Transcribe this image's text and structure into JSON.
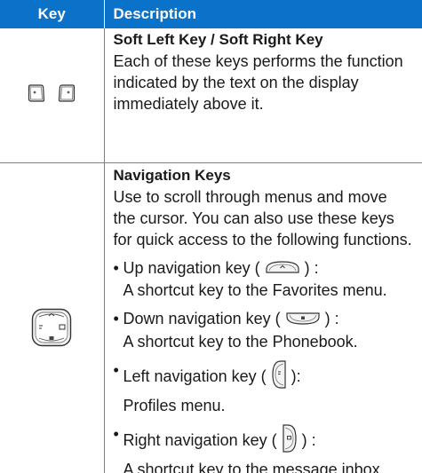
{
  "table": {
    "header": {
      "key": "Key",
      "description": "Description"
    },
    "rows": [
      {
        "title": "Soft Left Key / Soft Right Key",
        "text": "Each of these keys performs the function indicated by the text on the display immediately above it."
      },
      {
        "title": "Navigation Keys",
        "text": "Use to scroll through menus and move the cursor. You can also use these keys for quick access to the following functions.",
        "bullets": [
          {
            "lead": "Up navigation key (",
            "tail": ") :",
            "desc": "A shortcut key to the Favorites menu."
          },
          {
            "lead": "Down navigation key (",
            "tail": ") :",
            "desc": "A shortcut key to the Phonebook."
          },
          {
            "lead": "Left navigation key (",
            "tail": "):",
            "desc": "Profiles menu."
          },
          {
            "lead": "Right navigation key (",
            "tail": ") :",
            "desc": "A shortcut key to the message inbox"
          }
        ]
      }
    ]
  },
  "colors": {
    "header_bg": "#0b72c9",
    "header_text": "#ffffff",
    "rule": "#808080"
  },
  "icons": {
    "soft_keys": [
      "soft-left-key-icon",
      "soft-right-key-icon"
    ],
    "navigation_pad": "navigation-pad-icon",
    "up_key": "up-navigation-key-icon",
    "down_key": "down-navigation-key-icon",
    "left_key": "left-navigation-key-icon",
    "right_key": "right-navigation-key-icon"
  }
}
